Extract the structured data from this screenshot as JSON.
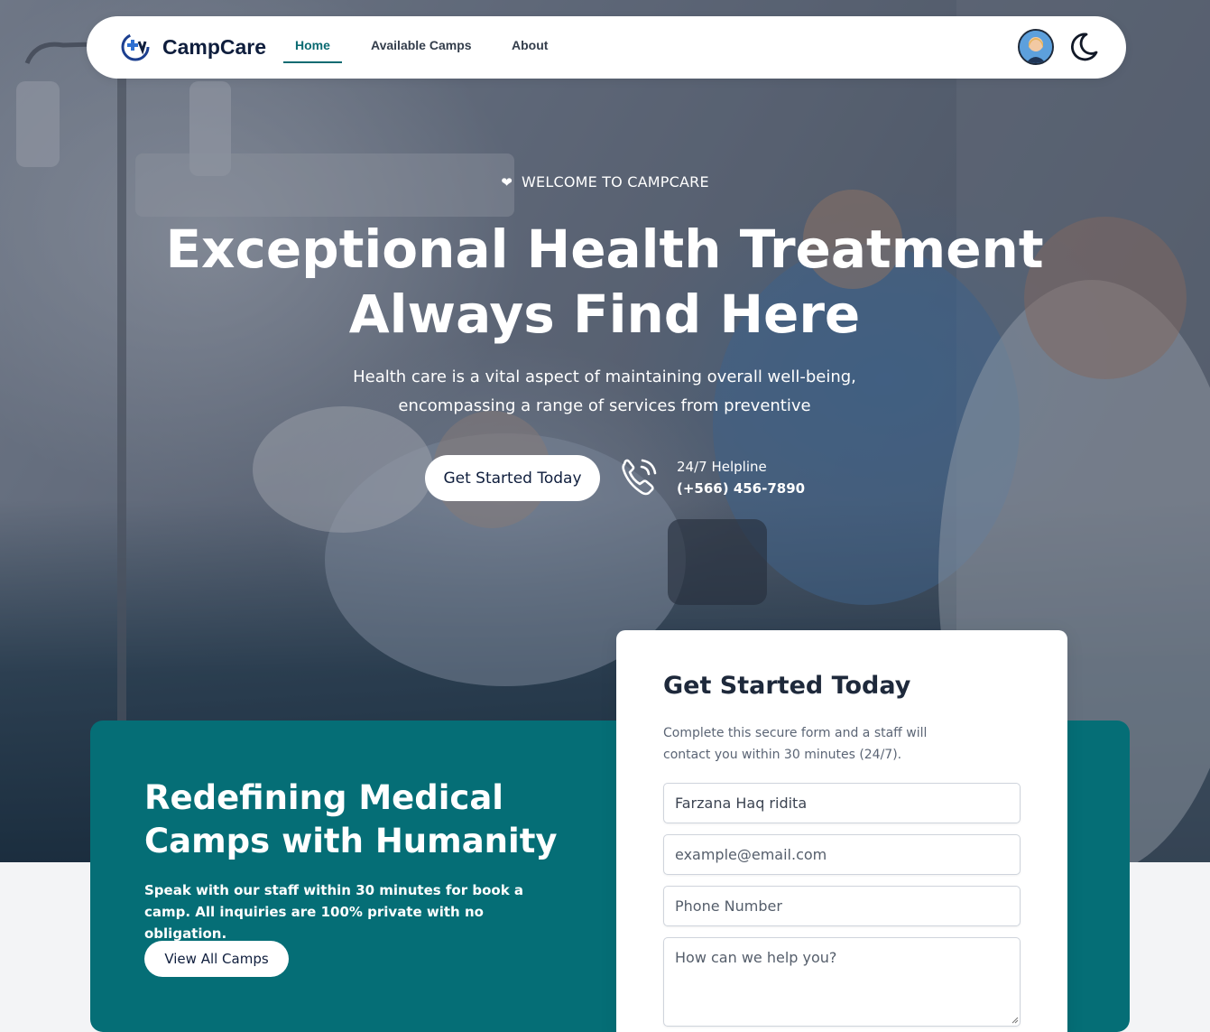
{
  "brand": {
    "name": "CampCare"
  },
  "nav": {
    "items": [
      {
        "label": "Home",
        "active": true
      },
      {
        "label": "Available Camps",
        "active": false
      },
      {
        "label": "About",
        "active": false
      }
    ],
    "icons": {
      "logo": "medical-cross-logo-icon",
      "avatar": "user-avatar",
      "theme": "moon-icon"
    }
  },
  "hero": {
    "eyebrow": "WELCOME TO CAMPCARE",
    "headline_line1": "Exceptional Health Treatment",
    "headline_line2": "Always Find Here",
    "subtext_line1": "Health care is a vital aspect of maintaining overall well-being,",
    "subtext_line2": "encompassing a range of services from preventive",
    "cta_label": "Get Started Today",
    "helpline_label": "24/7 Helpline",
    "helpline_number": "(+566) 456-7890"
  },
  "promo": {
    "title": "Redefining Medical Camps with Humanity",
    "text": "Speak with our staff within 30 minutes for book a camp. All inquiries are 100% private with no obligation.",
    "button_label": "View All Camps"
  },
  "form": {
    "title": "Get Started Today",
    "description": "Complete this secure form and a staff will contact you within 30 minutes (24/7).",
    "name_value": "Farzana Haq ridita",
    "email_placeholder": "example@email.com",
    "phone_placeholder": "Phone Number",
    "message_placeholder": "How can we help you?"
  },
  "colors": {
    "accent": "#056e76",
    "brand_text": "#0f1e3d",
    "nav_active": "#0b6b72"
  }
}
